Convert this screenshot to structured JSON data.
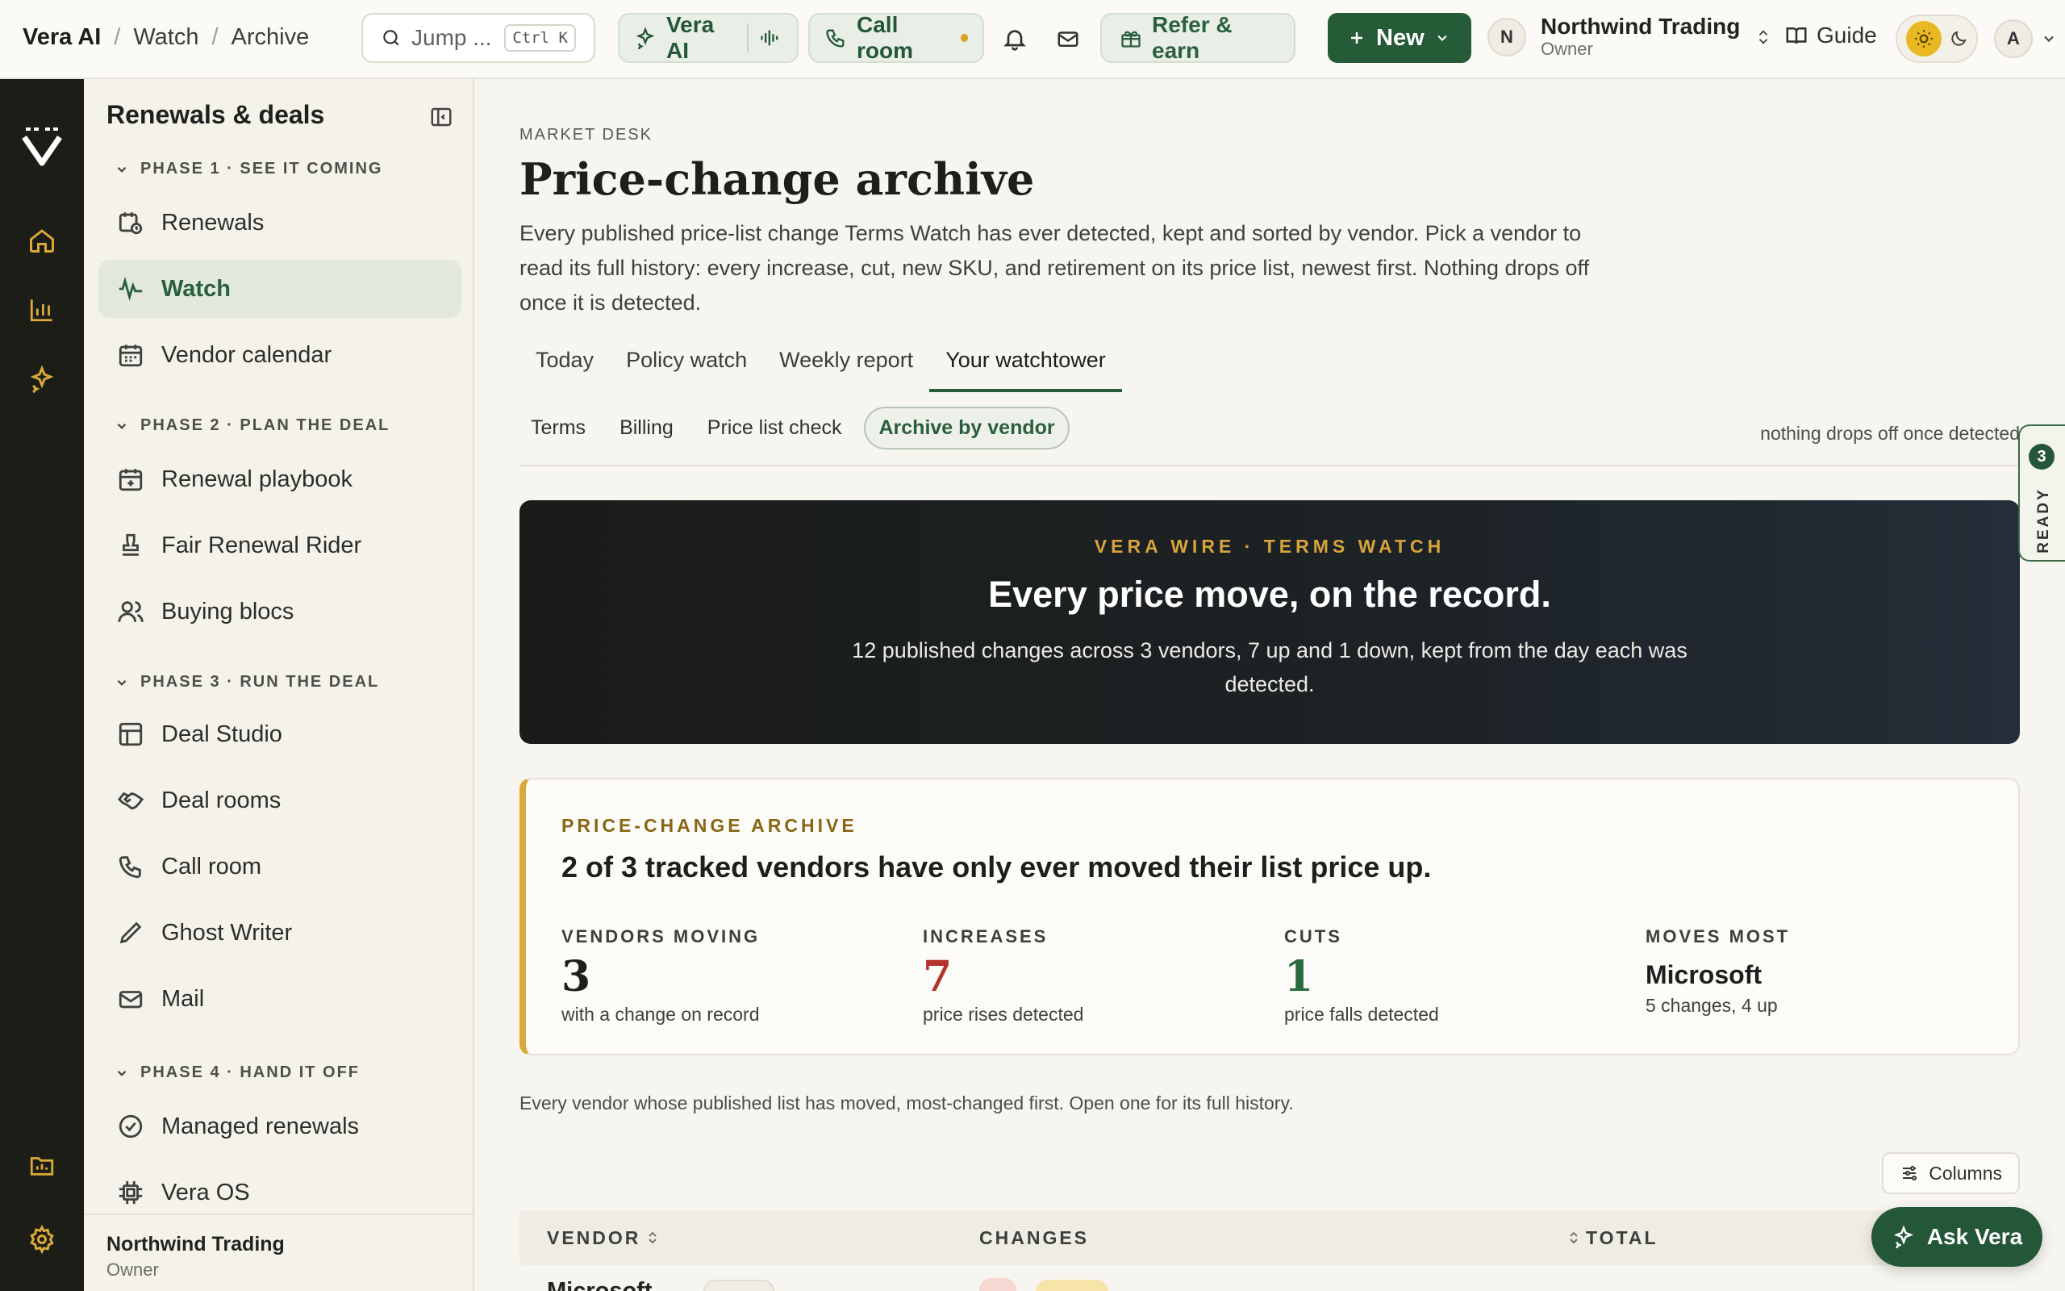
{
  "breadcrumb": [
    "Vera AI",
    "Watch",
    "Archive"
  ],
  "search": {
    "placeholder": "Jump ...",
    "shortcut": "Ctrl K"
  },
  "topbar": {
    "vera_ai": "Vera AI",
    "call_room": "Call room",
    "refer": "Refer & earn",
    "new": "New",
    "org_initial": "N",
    "org_name": "Northwind Trading",
    "org_role": "Owner",
    "guide": "Guide",
    "user_initial": "A"
  },
  "sidebar": {
    "title": "Renewals & deals",
    "phases": [
      {
        "label": "PHASE 1 · SEE IT COMING",
        "items": [
          "Renewals",
          "Watch",
          "Vendor calendar"
        ]
      },
      {
        "label": "PHASE 2 · PLAN THE DEAL",
        "items": [
          "Renewal playbook",
          "Fair Renewal Rider",
          "Buying blocs"
        ]
      },
      {
        "label": "PHASE 3 · RUN THE DEAL",
        "items": [
          "Deal Studio",
          "Deal rooms",
          "Call room",
          "Ghost Writer",
          "Mail"
        ]
      },
      {
        "label": "PHASE 4 · HAND IT OFF",
        "items": [
          "Managed renewals",
          "Vera OS"
        ]
      }
    ],
    "active_item": "Watch",
    "footer_name": "Northwind Trading",
    "footer_role": "Owner"
  },
  "page": {
    "eyebrow": "MARKET DESK",
    "title": "Price-change archive",
    "description": "Every published price-list change Terms Watch has ever detected, kept and sorted by vendor. Pick a vendor to read its full history: every increase, cut, new SKU, and retirement on its price list, newest first. Nothing drops off once it is detected.",
    "tabs": [
      "Today",
      "Policy watch",
      "Weekly report",
      "Your watchtower"
    ],
    "active_tab": "Your watchtower",
    "subtabs": [
      "Terms",
      "Billing",
      "Price list check",
      "Archive by vendor"
    ],
    "active_subtab": "Archive by vendor",
    "subnote": "nothing drops off once detected"
  },
  "wire": {
    "kicker": "VERA WIRE · TERMS WATCH",
    "title": "Every price move, on the record.",
    "subtitle": "12 published changes across 3 vendors, 7 up and 1 down, kept from the day each was detected."
  },
  "archive": {
    "kicker": "PRICE-CHANGE ARCHIVE",
    "headline": "2 of 3 tracked vendors have only ever moved their list price up.",
    "stats": [
      {
        "label": "VENDORS MOVING",
        "value": "3",
        "sub": "with a change on record",
        "color": "#1c201d"
      },
      {
        "label": "INCREASES",
        "value": "7",
        "sub": "price rises detected",
        "color": "#b3322b"
      },
      {
        "label": "CUTS",
        "value": "1",
        "sub": "price falls detected",
        "color": "#2a6b3f"
      },
      {
        "label": "MOVES MOST",
        "value": "Microsoft",
        "sub": "5 changes, 4 up",
        "color": "#1c201d"
      }
    ]
  },
  "list": {
    "note": "Every vendor whose published list has moved, most-changed first. Open one for its full history.",
    "columns_button": "Columns",
    "headers": [
      "VENDOR",
      "CHANGES",
      "TOTAL"
    ],
    "first_row_vendor": "Microsoft"
  },
  "ready": {
    "count": "3",
    "label": "READY"
  },
  "ask_vera": "Ask Vera"
}
